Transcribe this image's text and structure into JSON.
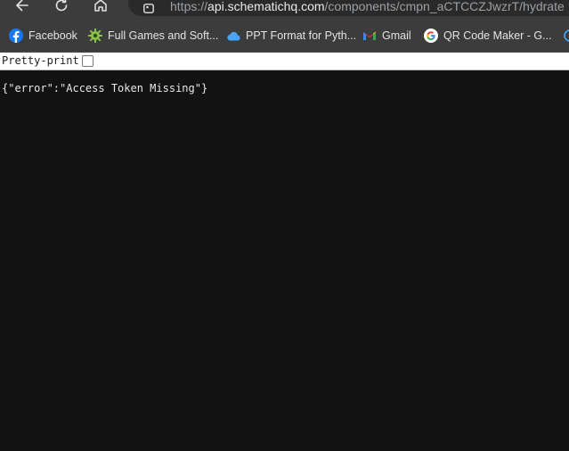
{
  "toolbar": {
    "back_icon": "arrow-left-icon",
    "reload_icon": "reload-icon",
    "home_icon": "home-icon",
    "site_info_icon": "tune-icon",
    "url_scheme": "https://",
    "url_host": "api.schematichq.com",
    "url_path": "/components/cmpn_aCTCCZJwzrT/hydrate"
  },
  "bookmarks": [
    {
      "label": "Facebook",
      "icon": "facebook-icon"
    },
    {
      "label": "Full Games and Soft...",
      "icon": "gear-icon"
    },
    {
      "label": "PPT Format for Pyth...",
      "icon": "cloud-icon"
    },
    {
      "label": "Gmail",
      "icon": "gmail-icon"
    },
    {
      "label": "QR Code Maker - G...",
      "icon": "google-icon"
    }
  ],
  "page": {
    "pretty_print_label": "Pretty-print",
    "pretty_print_checked": false,
    "json_text": "{\"error\":\"Access Token Missing\"}"
  },
  "colors": {
    "toolbar_bg": "#3c3c3c",
    "page_bg": "#121212",
    "facebook": "#1877f2",
    "cloud": "#4ba3f5",
    "google_blue": "#4285f4"
  }
}
